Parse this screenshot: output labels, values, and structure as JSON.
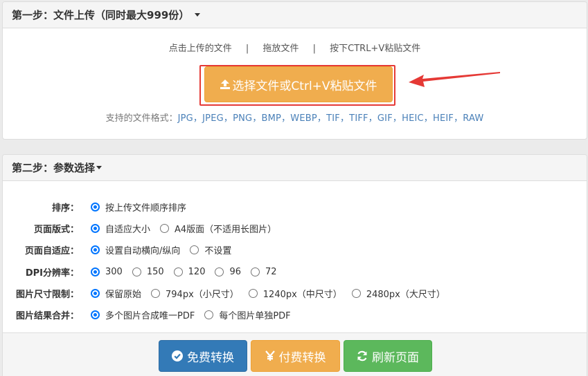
{
  "step1": {
    "title": "第一步：文件上传（同时最大999份）",
    "links": [
      "点击上传的文件",
      "拖放文件",
      "按下CTRL+V粘贴文件"
    ],
    "separator": "|",
    "upload_button": "选择文件或Ctrl+V粘贴文件",
    "formats_label": "支持的文件格式：",
    "formats": "JPG，JPEG，PNG，BMP，WEBP，TIF，TIFF，GIF，HEIC，HEIF，RAW"
  },
  "step2": {
    "title": "第二步：参数选择",
    "rows": [
      {
        "label": "排序：",
        "options": [
          {
            "text": "按上传文件顺序排序",
            "checked": true
          }
        ]
      },
      {
        "label": "页面版式：",
        "options": [
          {
            "text": "自适应大小",
            "checked": true
          },
          {
            "text": "A4版面（不适用长图片）",
            "checked": false
          }
        ]
      },
      {
        "label": "页面自适应：",
        "options": [
          {
            "text": "设置自动横向/纵向",
            "checked": true
          },
          {
            "text": "不设置",
            "checked": false
          }
        ]
      },
      {
        "label": "DPI分辨率：",
        "options": [
          {
            "text": "300",
            "checked": true
          },
          {
            "text": "150",
            "checked": false
          },
          {
            "text": "120",
            "checked": false
          },
          {
            "text": "96",
            "checked": false
          },
          {
            "text": "72",
            "checked": false
          }
        ]
      },
      {
        "label": "图片尺寸限制：",
        "options": [
          {
            "text": "保留原始",
            "checked": true
          },
          {
            "text": "794px（小尺寸）",
            "checked": false
          },
          {
            "text": "1240px（中尺寸）",
            "checked": false
          },
          {
            "text": "2480px（大尺寸）",
            "checked": false
          }
        ]
      },
      {
        "label": "图片结果合并：",
        "options": [
          {
            "text": "多个图片合成唯一PDF",
            "checked": true
          },
          {
            "text": "每个图片单独PDF",
            "checked": false
          }
        ]
      }
    ]
  },
  "actions": {
    "free": "免费转换",
    "paid": "付费转换",
    "refresh": "刷新页面"
  },
  "colors": {
    "warning": "#f0ad4e",
    "primary": "#337ab7",
    "success": "#5cb85c",
    "annotation": "#e53935",
    "radio": "#0075ff"
  },
  "icons": {
    "upload": "upload-icon",
    "free": "check-circle-icon",
    "paid": "yen-icon",
    "refresh": "refresh-icon"
  }
}
